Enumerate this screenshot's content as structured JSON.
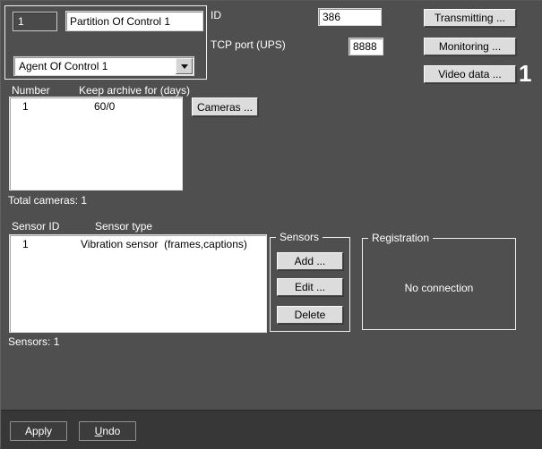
{
  "colors": {
    "panel_bg": "#4f4f4f",
    "footer_bg": "#373737",
    "field_bg": "#ffffff",
    "button_face": "#dcdcdc",
    "group_border": "#efefef"
  },
  "partition": {
    "id_value": "1",
    "name_value": "Partition Of Control 1",
    "agent_selected": "Agent Of Control 1"
  },
  "connection": {
    "id_label": "ID",
    "id_value": "386",
    "tcp_port_label": "TCP port (UPS)",
    "tcp_port_value": "8888"
  },
  "actions": {
    "transmitting_label": "Transmitting ...",
    "monitoring_label": "Monitoring ...",
    "video_data_label": "Video data ...",
    "video_data_badge": "1"
  },
  "cameras": {
    "columns": {
      "number": "Number",
      "archive": "Keep archive for (days)"
    },
    "rows": [
      {
        "number": "1",
        "archive": "60/0"
      }
    ],
    "cameras_button_label": "Cameras ...",
    "total_label": "Total cameras: 1"
  },
  "sensors": {
    "columns": {
      "id": "Sensor ID",
      "type": "Sensor type"
    },
    "rows": [
      {
        "id": "1",
        "type": "Vibration sensor  (frames,captions)"
      }
    ],
    "group_label": "Sensors",
    "add_label": "Add ...",
    "edit_label": "Edit ...",
    "delete_label": "Delete",
    "count_label": "Sensors: 1"
  },
  "registration": {
    "group_label": "Registration",
    "status": "No connection"
  },
  "footer": {
    "apply_label": "Apply",
    "undo_underlined": "U",
    "undo_rest": "ndo"
  }
}
